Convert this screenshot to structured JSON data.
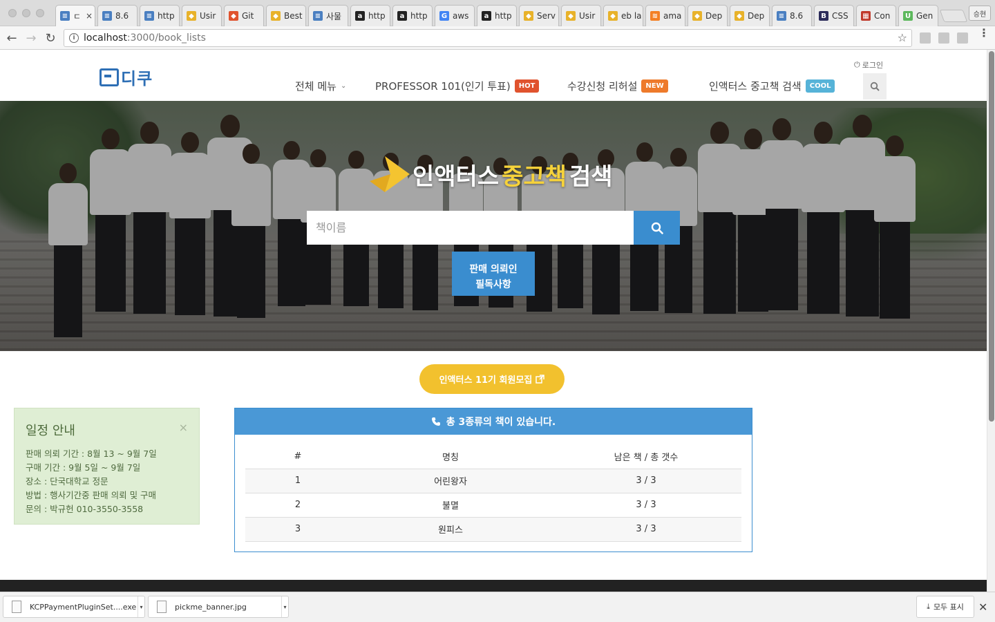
{
  "browser": {
    "tabs": [
      {
        "label": "ㄷ",
        "icon": "doc-icon",
        "color": "#4a7fc1",
        "active": true
      },
      {
        "label": "8.6",
        "icon": "docs-icon",
        "color": "#4a7fc1"
      },
      {
        "label": "http",
        "icon": "doc-icon",
        "color": "#4a7fc1"
      },
      {
        "label": "Usir",
        "icon": "stack-icon",
        "color": "#e8b22a"
      },
      {
        "label": "Git",
        "icon": "git-icon",
        "color": "#e0532e"
      },
      {
        "label": "Best",
        "icon": "stack-icon",
        "color": "#e8b22a"
      },
      {
        "label": "사물",
        "icon": "docs-icon",
        "color": "#4a7fc1"
      },
      {
        "label": "http",
        "icon": "amazon-icon",
        "color": "#222222"
      },
      {
        "label": "http",
        "icon": "amazon-icon",
        "color": "#222222"
      },
      {
        "label": "aws",
        "icon": "google-icon",
        "color": "#4285f4"
      },
      {
        "label": "http",
        "icon": "amazon-icon",
        "color": "#222222"
      },
      {
        "label": "Serv",
        "icon": "stack-icon",
        "color": "#e8b22a"
      },
      {
        "label": "Usir",
        "icon": "stack-icon",
        "color": "#e8b22a"
      },
      {
        "label": "eb la",
        "icon": "stack-icon",
        "color": "#e8b22a"
      },
      {
        "label": "ama",
        "icon": "so-icon",
        "color": "#f48024"
      },
      {
        "label": "Dep",
        "icon": "stack-icon",
        "color": "#e8b22a"
      },
      {
        "label": "Dep",
        "icon": "stack-icon",
        "color": "#e8b22a"
      },
      {
        "label": "8.6",
        "icon": "docs-icon",
        "color": "#4a7fc1"
      },
      {
        "label": "CSS",
        "icon": "bootstrap-icon",
        "color": "#2b2b5a"
      },
      {
        "label": "Con",
        "icon": "grid-icon",
        "color": "#c0392b"
      },
      {
        "label": "Gen",
        "icon": "u-icon",
        "color": "#5cb85c"
      }
    ],
    "profile_label": "승현",
    "url_host": "localhost",
    "url_path": ":3000/book_lists"
  },
  "header": {
    "logo_text": "디쿠",
    "login_label": "로그인",
    "nav": [
      {
        "label": "전체 메뉴",
        "badge": "",
        "badge_color": ""
      },
      {
        "label": "PROFESSOR 101(인기 투표)",
        "badge": "HOT",
        "badge_color": "#e0532e"
      },
      {
        "label": "수강신청 리허설",
        "badge": "NEW",
        "badge_color": "#ee7a2b"
      },
      {
        "label": "인액터스 중고책 검색",
        "badge": "COOL",
        "badge_color": "#56b3d8"
      }
    ]
  },
  "hero": {
    "title_pre": "인액터스",
    "title_highlight": "중고책",
    "title_post": "검색",
    "search_placeholder": "책이름",
    "notice_line1": "판매 의뢰인",
    "notice_line2": "필독사항"
  },
  "recruit_label": "인액터스 11기 회원모집",
  "schedule": {
    "title": "일정 안내",
    "lines": [
      "판매 의뢰 기간 : 8월 13 ~ 9월 7일",
      "구매 기간 : 9월 5일 ~ 9월 7일",
      "장소 : 단국대학교 정문",
      "방법 : 행사기간중 판매 의뢰 및 구매",
      "문의 : 박규헌 010-3550-3558"
    ]
  },
  "books": {
    "heading": "총 3종류의 책이 있습니다.",
    "columns": [
      "#",
      "명칭",
      "남은 책 / 총 갯수"
    ],
    "rows": [
      {
        "num": "1",
        "name": "어린왕자",
        "count": "3 / 3"
      },
      {
        "num": "2",
        "name": "불멸",
        "count": "3 / 3"
      },
      {
        "num": "3",
        "name": "원피스",
        "count": "3 / 3"
      }
    ]
  },
  "downloads": {
    "items": [
      {
        "name": "KCPPaymentPluginSet....exe"
      },
      {
        "name": "pickme_banner.jpg"
      }
    ],
    "show_all_label": "모두 표시"
  }
}
